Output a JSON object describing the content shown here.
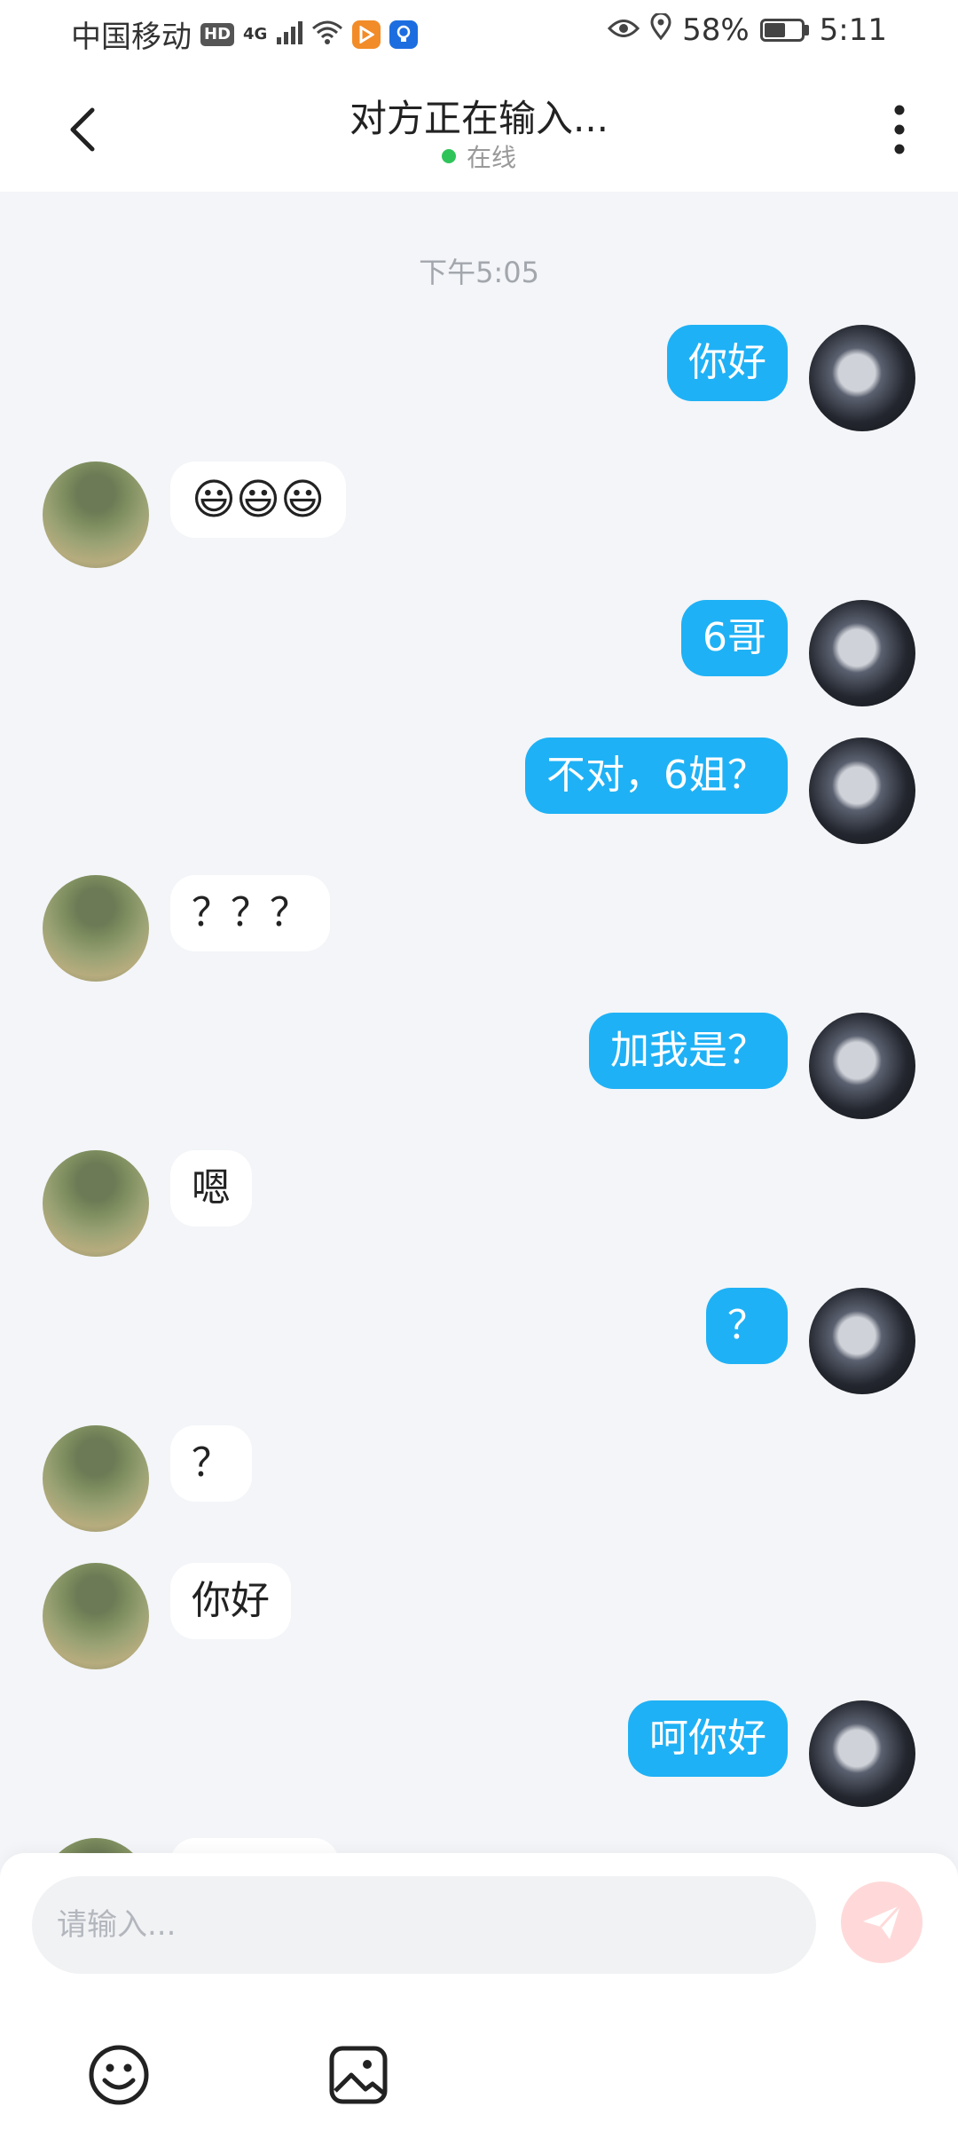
{
  "status_bar": {
    "carrier": "中国移动",
    "hd": "HD",
    "network": "4G",
    "battery": "58%",
    "battery_level": 0.58,
    "time": "5:11"
  },
  "header": {
    "title": "对方正在输入...",
    "status": "在线",
    "status_color": "#2fc45a"
  },
  "chat": {
    "time_label": "下午5:05",
    "messages": [
      {
        "side": "right",
        "text": "你好"
      },
      {
        "side": "left",
        "text": "😃😃😃",
        "emoji_count": 3
      },
      {
        "side": "right",
        "text": "6哥"
      },
      {
        "side": "right",
        "text": "不对，6姐？"
      },
      {
        "side": "left",
        "text": "？？？"
      },
      {
        "side": "right",
        "text": "加我是？"
      },
      {
        "side": "left",
        "text": "嗯"
      },
      {
        "side": "right",
        "text": "？"
      },
      {
        "side": "left",
        "text": "？"
      },
      {
        "side": "left",
        "text": "你好"
      },
      {
        "side": "right",
        "text": "呵你好"
      }
    ],
    "bubble_color_me": "#1fb1f5",
    "bubble_color_other": "#ffffff"
  },
  "composer": {
    "placeholder": "请输入...",
    "send_icon": "paper-plane-icon",
    "tools": [
      "emoji-icon",
      "image-icon"
    ]
  }
}
